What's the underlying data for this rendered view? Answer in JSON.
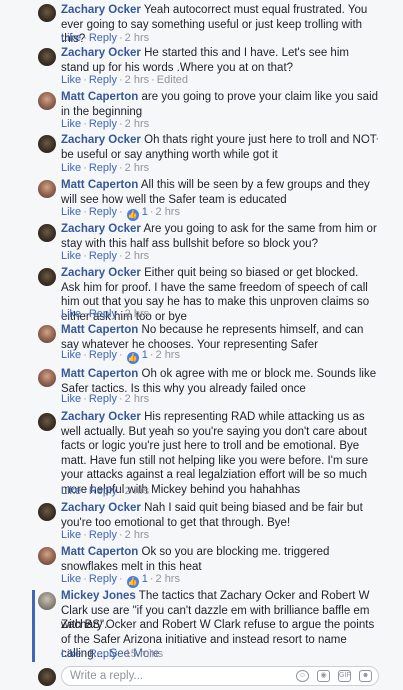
{
  "comments": [
    {
      "author": "Zachary Ocker",
      "avatar": "zach",
      "text": "Yeah autocorrect must equal frustrated. You ever going to say something useful or just keep trolling with this?",
      "like": "Like",
      "reply": "Reply",
      "time": "2 hrs",
      "edited": "",
      "likes": ""
    },
    {
      "author": "Zachary Ocker",
      "avatar": "zach",
      "text": "He started this and I have. Let's see him stand up for his words .Where you at on that?",
      "like": "Like",
      "reply": "Reply",
      "time": "2 hrs",
      "edited": "Edited",
      "likes": ""
    },
    {
      "author": "Matt Caperton",
      "avatar": "matt",
      "text": "are you going to prove your claim like you said in the beginning",
      "like": "Like",
      "reply": "Reply",
      "time": "2 hrs",
      "edited": "",
      "likes": ""
    },
    {
      "author": "Zachary Ocker",
      "avatar": "zach",
      "text": "Oh thats right youre just here to troll and NOT be useful or say anything worth while got it",
      "like": "Like",
      "reply": "Reply",
      "time": "2 hrs",
      "edited": "",
      "likes": ""
    },
    {
      "author": "Matt Caperton",
      "avatar": "matt",
      "text": "All this will be seen by a few groups and they will see how well the Safer team is educated",
      "like": "Like",
      "reply": "Reply",
      "time": "2 hrs",
      "edited": "",
      "likes": "1"
    },
    {
      "author": "Zachary Ocker",
      "avatar": "zach",
      "text": "Are you going to ask for the same from him or stay with this half ass bullshit before so block you?",
      "like": "Like",
      "reply": "Reply",
      "time": "2 hrs",
      "edited": "",
      "likes": ""
    },
    {
      "author": "Zachary Ocker",
      "avatar": "zach",
      "text": "Either quit being so biased or get blocked. Ask him for proof. I have the same freedom of speech of call him out that you say he has to make this unproven claims so either ask him too or bye",
      "like": "Like",
      "reply": "Reply",
      "time": "2 hrs",
      "edited": "",
      "likes": ""
    },
    {
      "author": "Matt Caperton",
      "avatar": "matt",
      "text": "No because he represents himself, and can say whatever he chooses. Your representing Safer",
      "like": "Like",
      "reply": "Reply",
      "time": "2 hrs",
      "edited": "",
      "likes": "1"
    },
    {
      "author": "Matt Caperton",
      "avatar": "matt",
      "text": "Oh ok agree with me or block me. Sounds like Safer tactics. Is this why you already failed once",
      "like": "Like",
      "reply": "Reply",
      "time": "2 hrs",
      "edited": "",
      "likes": ""
    },
    {
      "author": "Zachary Ocker",
      "avatar": "zach",
      "text": "His representing RAD while attacking us as well actually. But yeah so you're saying you don't care about facts or logic you're just here to troll and be emotional. Bye matt. Have fun still not helping like you were before. I'm sure your attacks against a real legalziation effort will be so much more helpful with Mickey behind you hahahhas",
      "like": "Like",
      "reply": "Reply",
      "time": "2 hrs",
      "edited": "",
      "likes": ""
    },
    {
      "author": "Zachary Ocker",
      "avatar": "zach",
      "text": "Nah I said quit being biased and be fair but you're too emotional to get that through. Bye!",
      "like": "Like",
      "reply": "Reply",
      "time": "2 hrs",
      "edited": "",
      "likes": ""
    },
    {
      "author": "Matt Caperton",
      "avatar": "matt",
      "text": "Ok so you are blocking me. triggered snowflakes melt in this heat",
      "like": "Like",
      "reply": "Reply",
      "time": "2 hrs",
      "edited": "",
      "likes": "1"
    },
    {
      "author": "Mickey Jones",
      "avatar": "mickey",
      "text": "The tactics that Zachary Ocker and Robert W Clark use are \"if you can't dazzle em with brilliance baffle em with BS\".",
      "text2": "Zachary Ocker and Robert W Clark refuse to argue the points of the Safer Arizona initiative and instead resort to name calling....",
      "see_more": "See More",
      "like": "Like",
      "reply": "Reply",
      "time": "15 mins",
      "edited": "",
      "likes": ""
    }
  ],
  "reply_box": {
    "placeholder": "Write a reply...",
    "icons": [
      "emoji-icon",
      "camera-icon",
      "gif-icon",
      "sticker-icon"
    ]
  },
  "colors": {
    "link": "#4267b2",
    "author": "#365899",
    "meta": "#90949c"
  }
}
